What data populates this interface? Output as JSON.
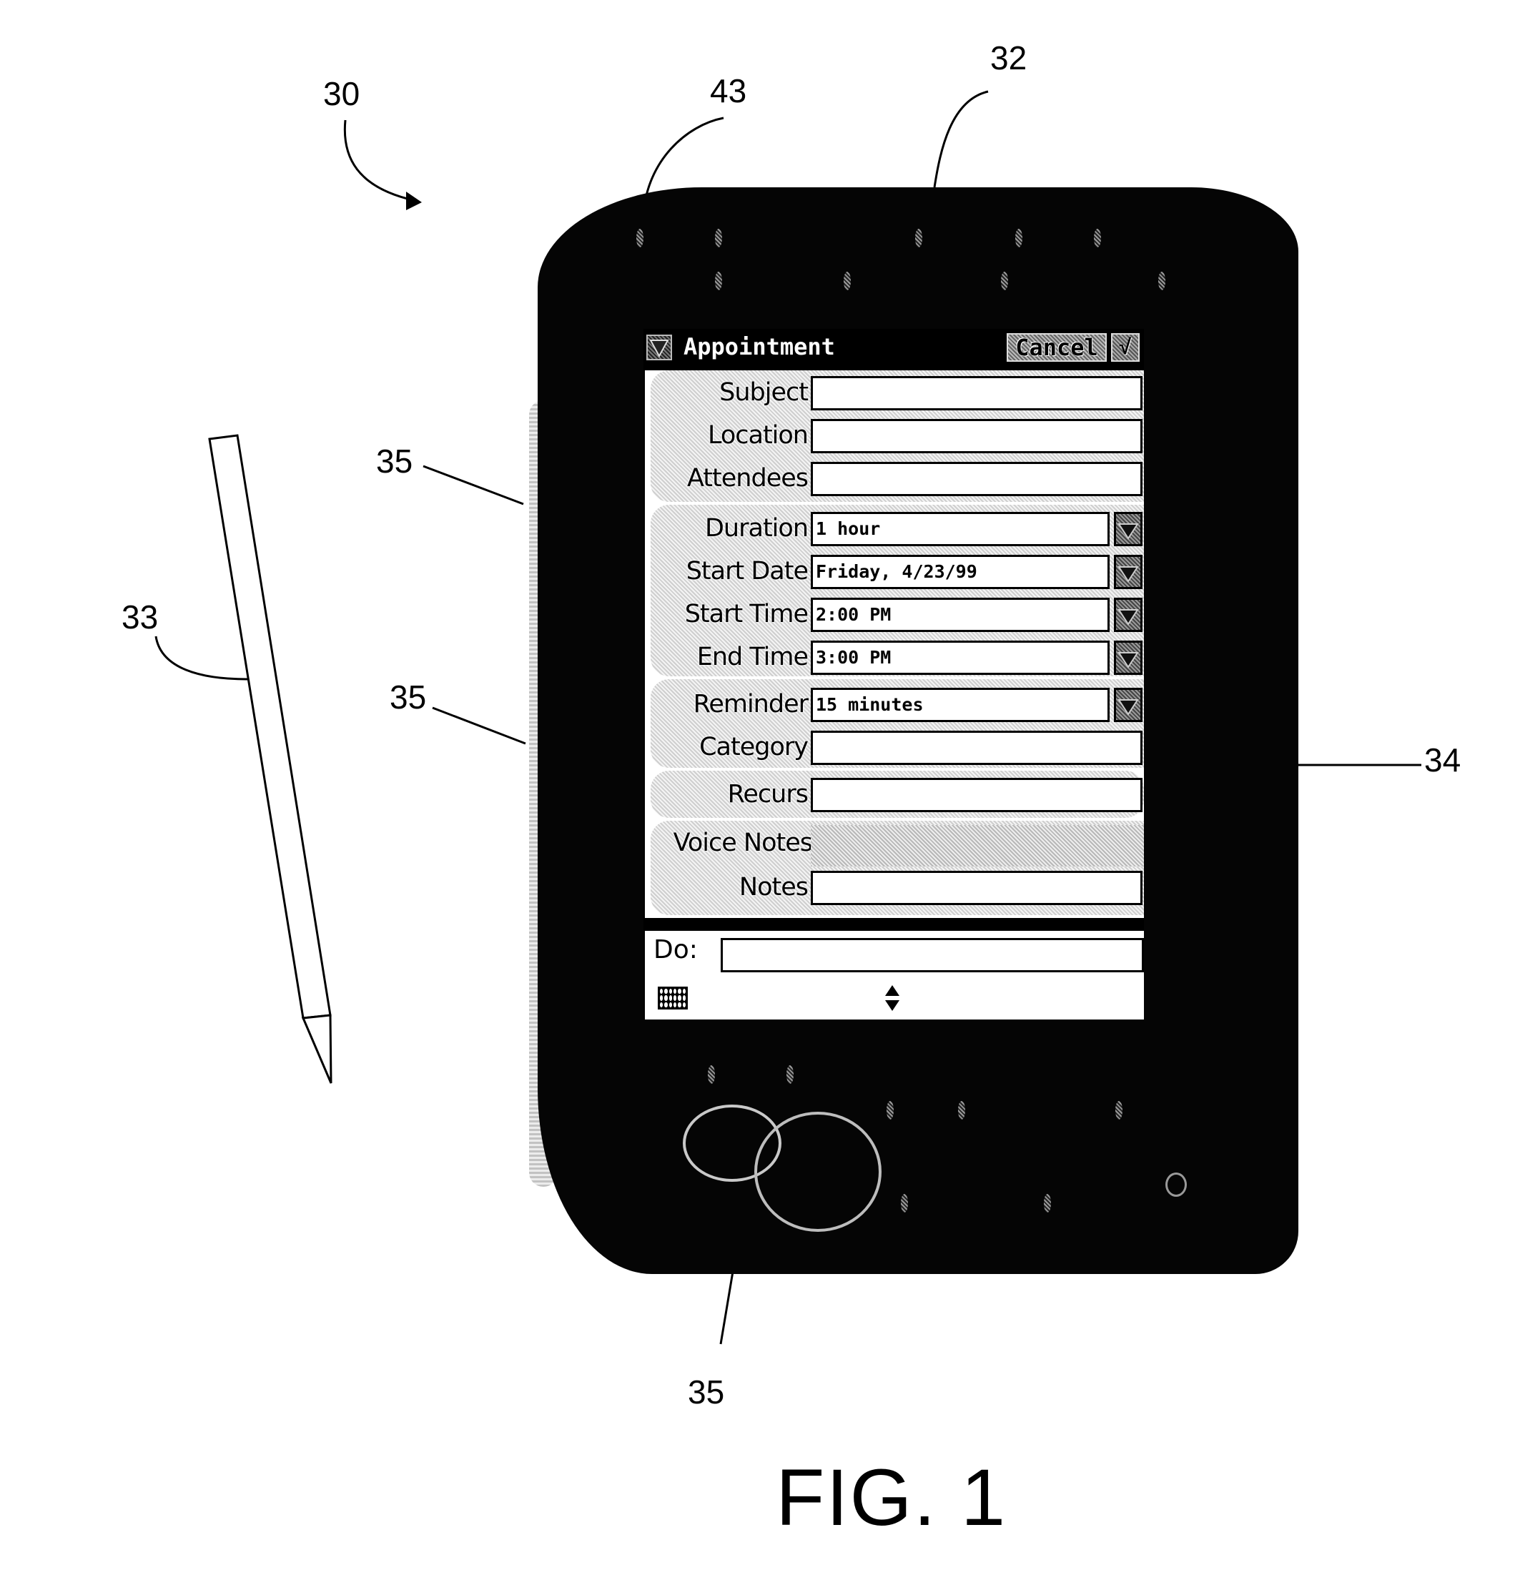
{
  "figure": {
    "caption": "FIG. 1",
    "reference_numerals": {
      "device": "30",
      "housing_edge": "43",
      "housing": "32",
      "stylus": "33",
      "display": "34",
      "button_upper_side": "35",
      "button_lower_side": "35",
      "button_front": "35"
    }
  },
  "screen": {
    "title": "Appointment",
    "title_icon": "dropdown-triangle-icon",
    "buttons": {
      "cancel": "Cancel",
      "ok": "√"
    },
    "form": {
      "fields": [
        {
          "label": "Subject",
          "value": "",
          "type": "text"
        },
        {
          "label": "Location",
          "value": "",
          "type": "text"
        },
        {
          "label": "Attendees",
          "value": "",
          "type": "text"
        },
        {
          "label": "Duration",
          "value": "1 hour",
          "type": "dropdown"
        },
        {
          "label": "Start Date",
          "value": "Friday, 4/23/99",
          "type": "dropdown"
        },
        {
          "label": "Start Time",
          "value": "2:00 PM",
          "type": "dropdown"
        },
        {
          "label": "End Time",
          "value": "3:00 PM",
          "type": "dropdown"
        },
        {
          "label": "Reminder",
          "value": "15 minutes",
          "type": "dropdown"
        },
        {
          "label": "Category",
          "value": "",
          "type": "text"
        },
        {
          "label": "Recurs",
          "value": "",
          "type": "text"
        },
        {
          "label": "Voice Notes",
          "value": "",
          "type": "voice"
        },
        {
          "label": "Notes",
          "value": "",
          "type": "text"
        }
      ]
    },
    "command_bar": {
      "do_label": "Do:",
      "do_value": "",
      "keyboard_icon": "keyboard-icon",
      "scroll_icon": "up-down-arrows-icon"
    }
  }
}
